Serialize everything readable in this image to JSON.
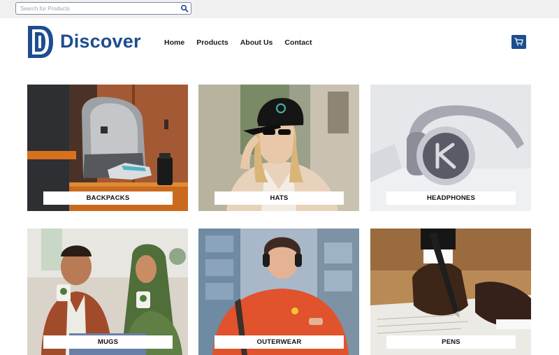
{
  "search": {
    "placeholder": "Search for Products",
    "value": "",
    "icon": "search-icon"
  },
  "brand": {
    "name": "Discover",
    "color": "#1d4d8f"
  },
  "nav": {
    "items": [
      {
        "label": "Home"
      },
      {
        "label": "Products"
      },
      {
        "label": "About Us"
      },
      {
        "label": "Contact"
      }
    ]
  },
  "cart": {
    "icon": "cart-icon",
    "color": "#1d4d8f"
  },
  "categories": [
    {
      "label": "BACKPACKS"
    },
    {
      "label": "HATS"
    },
    {
      "label": "HEADPHONES"
    },
    {
      "label": "MUGS"
    },
    {
      "label": "OUTERWEAR"
    },
    {
      "label": "PENS"
    }
  ]
}
